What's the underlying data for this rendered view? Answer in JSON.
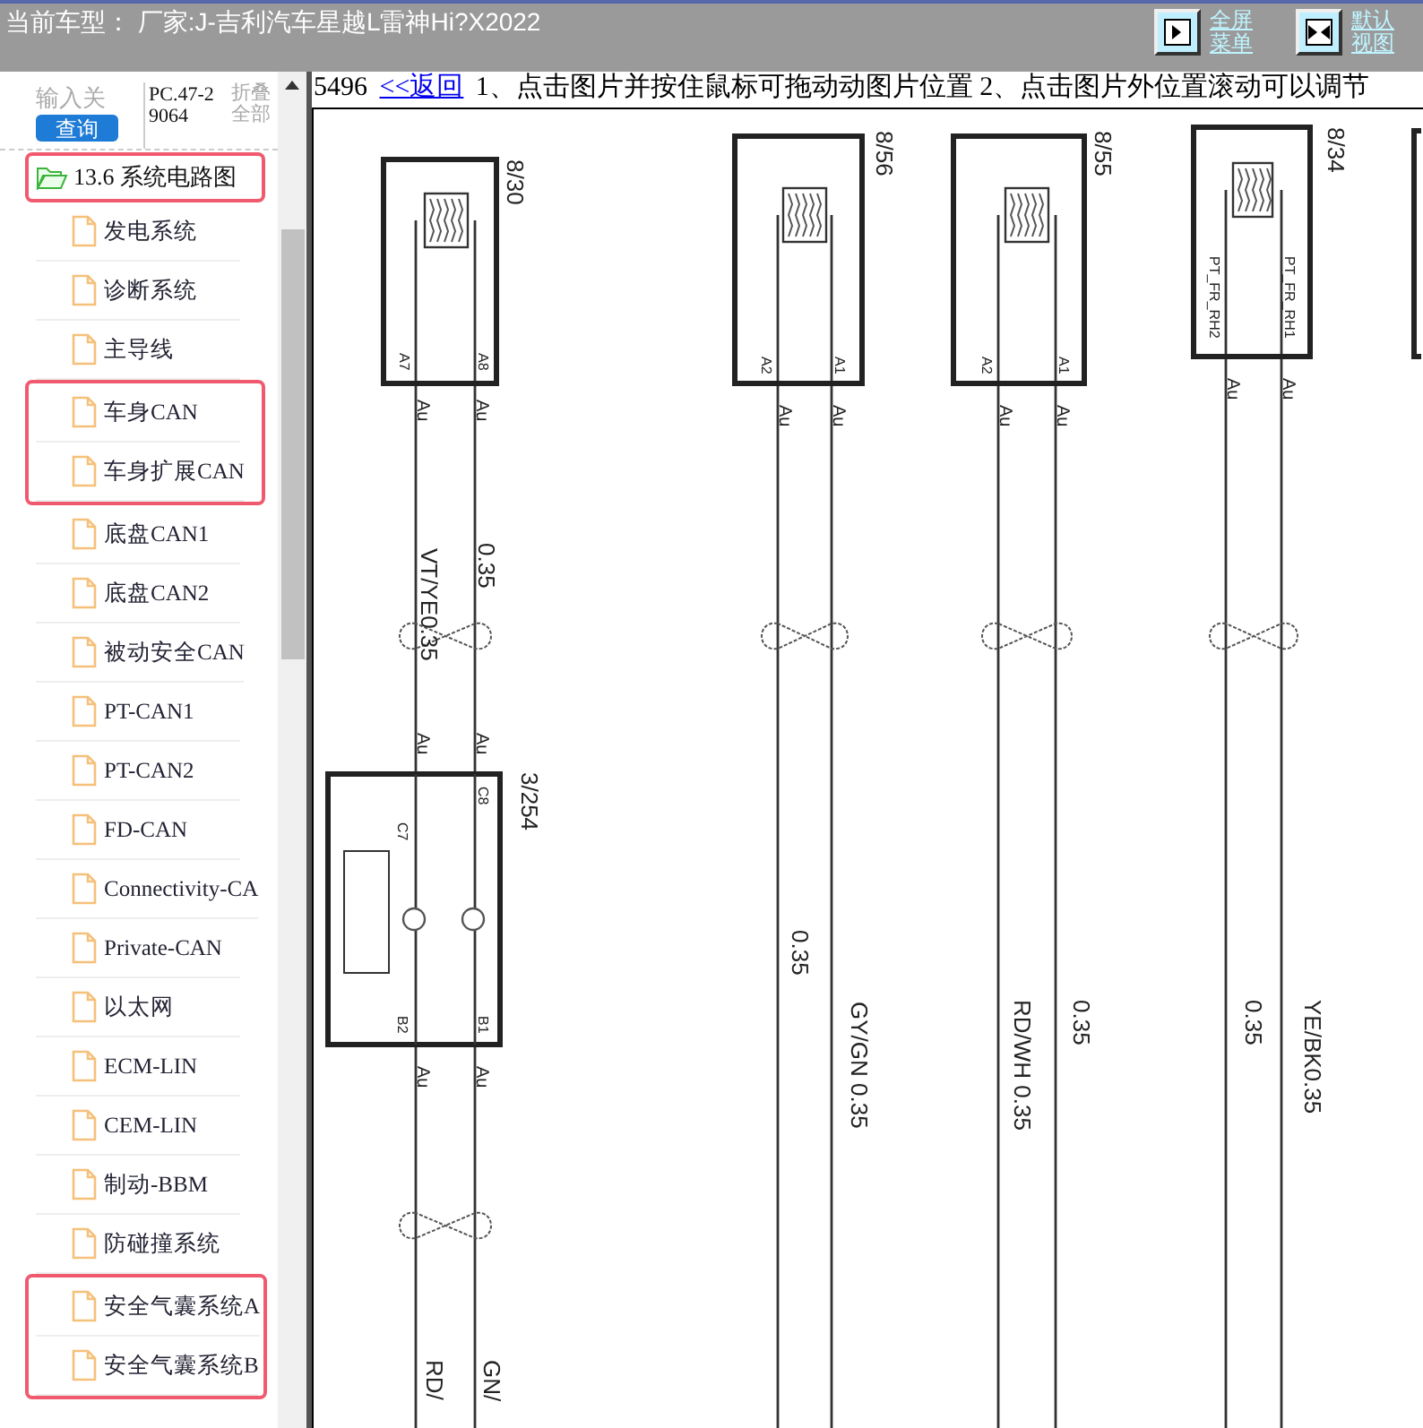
{
  "header": {
    "vehicle": "当前车型： 厂家:J-吉利汽车星越L雷神Hi?X2022",
    "buttons": [
      {
        "kind": "fullscreen",
        "label": "全屏菜单"
      },
      {
        "kind": "default-view",
        "label": "默认视图"
      }
    ]
  },
  "sidebar": {
    "search": {
      "placeholder": "输入关"
    },
    "search_button": "查询",
    "code": "PC.47-29064",
    "collapse_all": "折叠全部",
    "tree": {
      "label": "13.6 系统电路图",
      "expanded": true,
      "highlighted": true,
      "children": [
        {
          "label": "发电系统",
          "highlighted": false
        },
        {
          "label": "诊断系统",
          "highlighted": false
        },
        {
          "label": "主导线",
          "highlighted": false
        },
        {
          "label": "车身CAN",
          "highlighted": true
        },
        {
          "label": "车身扩展CAN",
          "highlighted": true
        },
        {
          "label": "底盘CAN1",
          "highlighted": false
        },
        {
          "label": "底盘CAN2",
          "highlighted": false
        },
        {
          "label": "被动安全CAN",
          "highlighted": false
        },
        {
          "label": "PT-CAN1",
          "highlighted": false
        },
        {
          "label": "PT-CAN2",
          "highlighted": false
        },
        {
          "label": "FD-CAN",
          "highlighted": false
        },
        {
          "label": "Connectivity-CA",
          "highlighted": false
        },
        {
          "label": "Private-CAN",
          "highlighted": false
        },
        {
          "label": "以太网",
          "highlighted": false
        },
        {
          "label": "ECM-LIN",
          "highlighted": false
        },
        {
          "label": "CEM-LIN",
          "highlighted": false
        },
        {
          "label": "制动-BBM",
          "highlighted": false
        },
        {
          "label": "防碰撞系统",
          "highlighted": false
        },
        {
          "label": "安全气囊系统A",
          "highlighted": true
        },
        {
          "label": "安全气囊系统B",
          "highlighted": true
        }
      ]
    }
  },
  "content": {
    "page_number": "5496",
    "back_link": "<<返回",
    "instructions": "1、点击图片并按住鼠标可拖动动图片位置 2、点击图片外位置滚动可以调节",
    "diagram": {
      "connectors": [
        {
          "label": "8/30",
          "pins": [
            "A7",
            "A8"
          ],
          "terminals": [
            "Au",
            "Au"
          ]
        },
        {
          "label": "8/56",
          "pins": [
            "A2",
            "A1"
          ],
          "terminals": [
            "Au",
            "Au"
          ]
        },
        {
          "label": "8/55",
          "pins": [
            "A2",
            "A1"
          ],
          "terminals": [
            "Au",
            "Au"
          ]
        },
        {
          "label": "8/34",
          "pins": [
            "PT_FR_RH2",
            "PT_FR_RH1"
          ],
          "terminals": [
            "Au",
            "Au"
          ]
        },
        {
          "label": "3/254",
          "pins": [
            "C7",
            "C8",
            "B2",
            "B1"
          ],
          "terminals": [
            "Au",
            "Au",
            "Au",
            "Au"
          ]
        }
      ],
      "wire_labels": [
        "0.35",
        "VT/YE0.35",
        "0.35",
        "GY/GN 0.35",
        "RD/WH 0.35",
        "0.35",
        "0.35",
        "YE/BK0.35",
        "RD/",
        "GN/"
      ]
    }
  }
}
